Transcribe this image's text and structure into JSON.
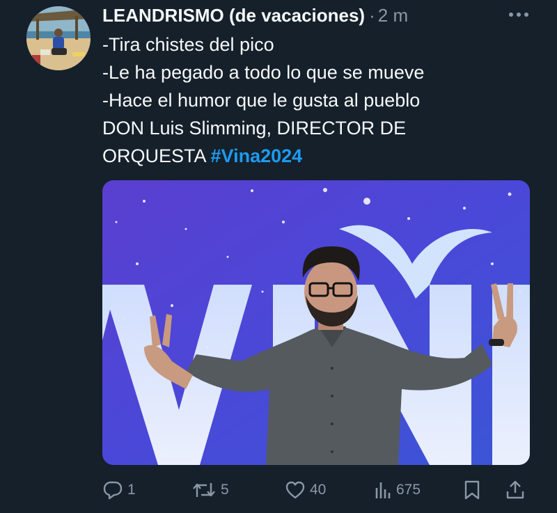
{
  "tweet": {
    "author_name": "LEANDRISMO (de vacaciones)",
    "separator": "·",
    "timestamp": "2 m",
    "lines": [
      "-Tira chistes del pico",
      "-Le ha pegado a todo lo que se mueve",
      "-Hace el humor que le gusta al pueblo",
      "DON Luis Slimming, DIRECTOR DE",
      "ORQUESTA "
    ],
    "hashtag": "#Vina2024",
    "media_icon": "photo-of-man-on-stage"
  },
  "actions": {
    "reply_count": "1",
    "retweet_count": "5",
    "like_count": "40",
    "views_count": "675"
  },
  "icons": {
    "reply": "speech-bubble-icon",
    "retweet": "retweet-arrows-icon",
    "like": "heart-icon",
    "views": "bar-chart-icon",
    "bookmark": "bookmark-icon",
    "share": "share-upload-icon",
    "more": "more-dots-icon"
  },
  "colors": {
    "background": "#15202b",
    "text": "#f7f9f9",
    "secondary": "#8b98a5",
    "accent": "#1d9bf0"
  }
}
